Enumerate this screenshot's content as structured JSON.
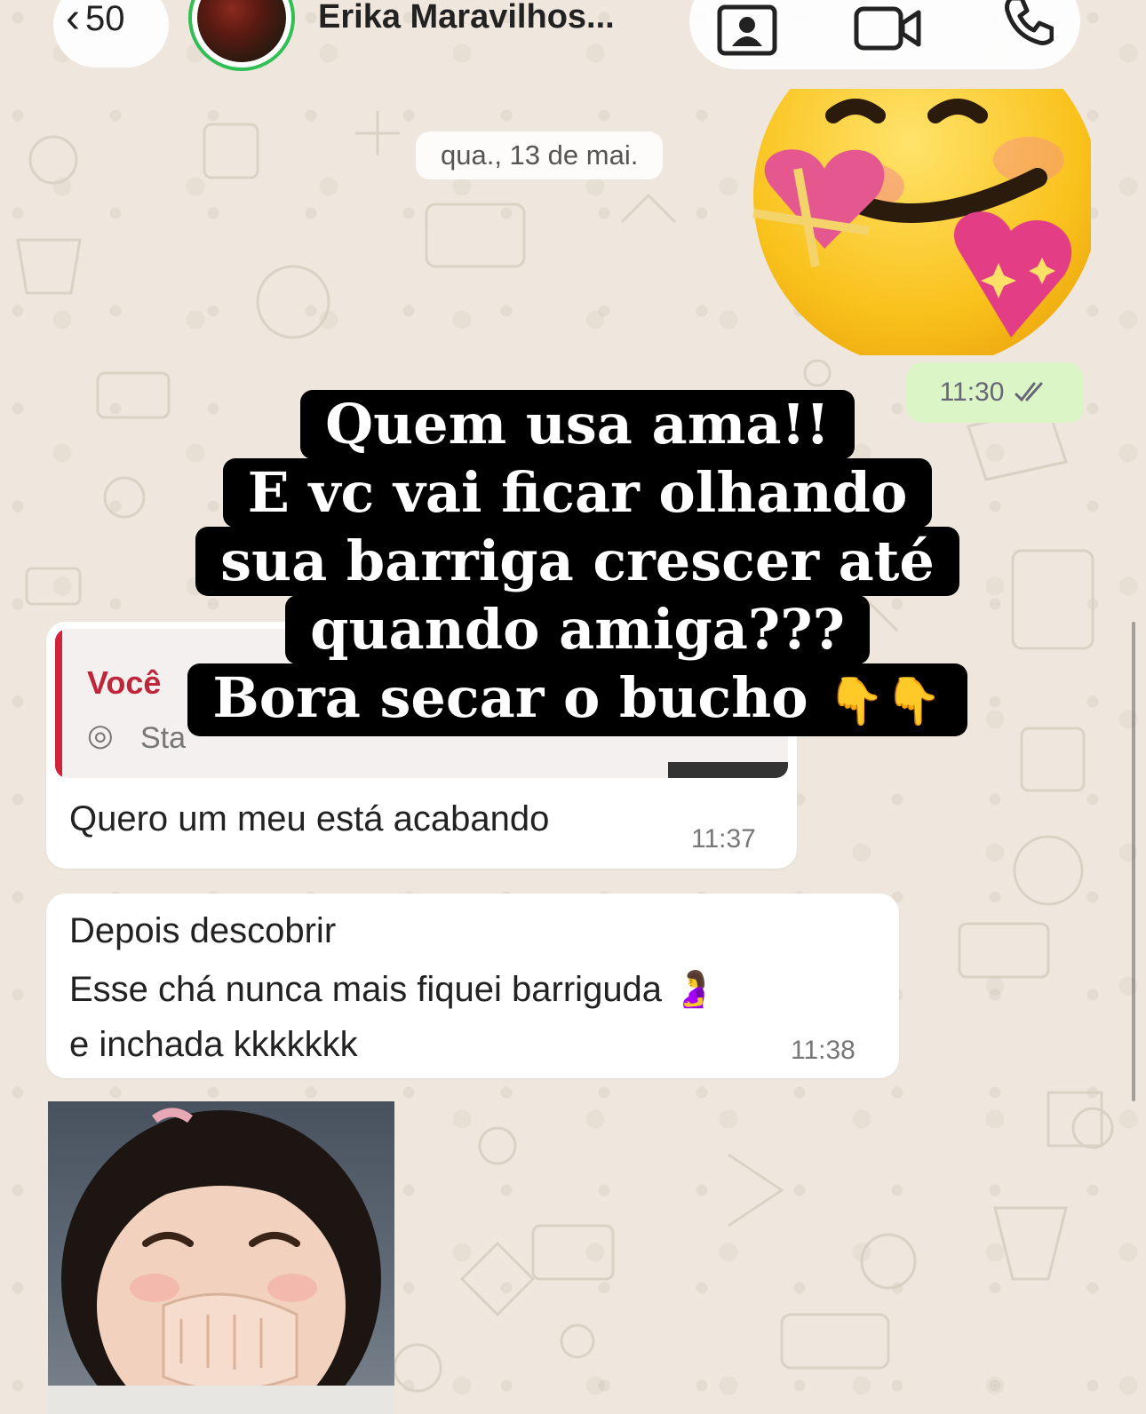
{
  "header": {
    "back_glyph": "‹",
    "back_count": "50",
    "contact_name": "Erika Maravilhos...",
    "icons": [
      "contact-card-icon",
      "video-call-icon",
      "phone-icon"
    ]
  },
  "chat": {
    "date_chip": "qua., 13 de mai.",
    "sticker": "smiling-face-with-hearts-emoji",
    "outgoing_time": "11:30",
    "read_receipt": "double-check",
    "reply_message": {
      "quoted_author": "Você",
      "quoted_status_icon": "◎",
      "quoted_status": "Sta",
      "text": "Quero um meu está acabando",
      "time": "11:37"
    },
    "message": {
      "lines": [
        "Depois descobrir",
        "Esse chá nunca mais fiquei barriguda 🤰",
        "e inchada kkkkkkk"
      ],
      "time": "11:38"
    }
  },
  "caption": {
    "lines": [
      "Quem usa ama!!",
      "E vc vai ficar olhando",
      "sua barriga crescer até",
      "quando amiga???",
      "Bora secar o bucho"
    ],
    "emoji": "👇👇"
  },
  "colors": {
    "background": "#efe7dd",
    "outgoing_bubble": "#dcf5c6",
    "quote_accent": "#d0243c",
    "status_ring": "#2fbf55",
    "caption_bg": "#000000"
  }
}
